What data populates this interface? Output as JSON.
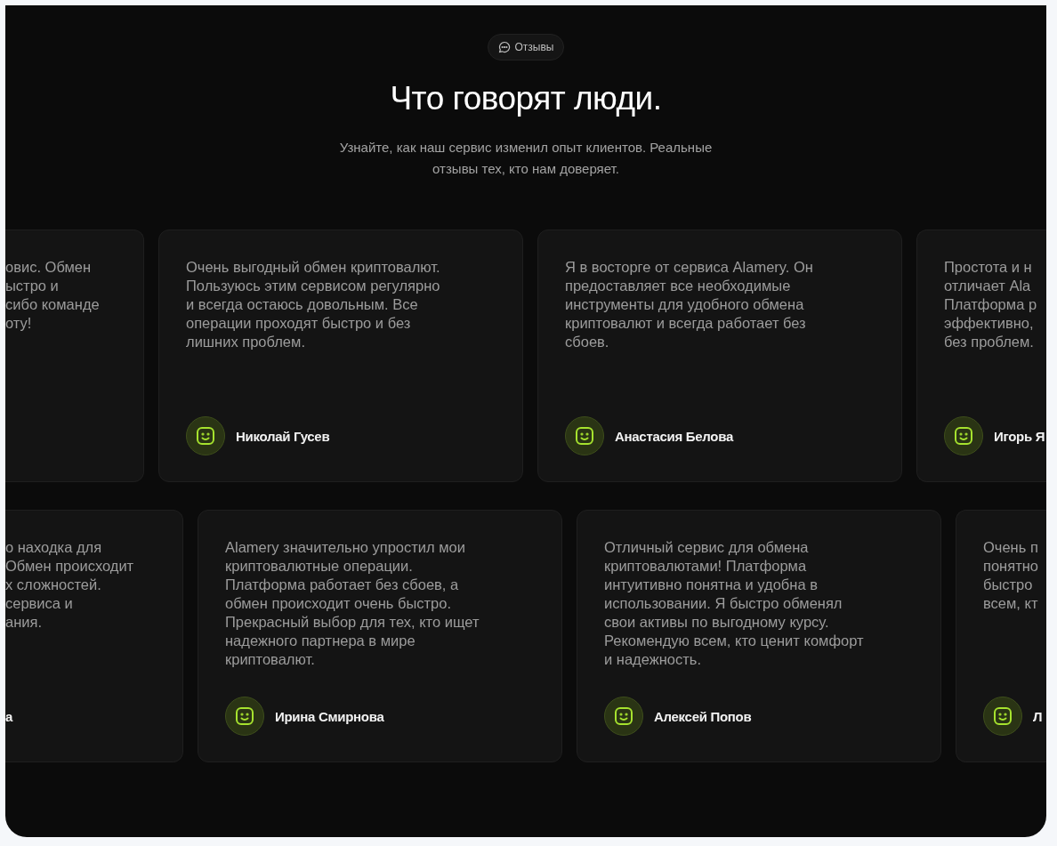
{
  "badge": {
    "label": "Отзывы"
  },
  "title": "Что говорят люди.",
  "subtitle_lines": [
    "Узнайте, как наш сервис изменил опыт клиентов. Реальные",
    "отзывы тех, кто нам доверяет."
  ],
  "rows": [
    {
      "cards": [
        {
          "kind": "cut_left",
          "lines": [
            "овис. Обмен",
            "ыстро и",
            "сибо команде",
            "оту!"
          ]
        },
        {
          "kind": "full",
          "lines": [
            "Очень выгодный обмен криптовалют.",
            "Пользуюсь этим сервисом регулярно",
            "и всегда остаюсь довольным. Все",
            "операции проходят быстро и без",
            "лишних проблем."
          ],
          "name": "Николай Гусев"
        },
        {
          "kind": "full",
          "lines": [
            "Я в восторге от сервиса Alamery. Он",
            "предоставляет все необходимые",
            "инструменты для удобного обмена",
            "криптовалют и всегда работает без",
            "сбоев."
          ],
          "name": "Анастасия Белова"
        },
        {
          "kind": "cut_right",
          "lines": [
            "Простота и н",
            "отличает Ala",
            "Платформа р",
            "эффективно,",
            "без проблем."
          ],
          "name": "Игорь Я"
        }
      ]
    },
    {
      "cards": [
        {
          "kind": "cut_left",
          "lines": [
            "о находка для",
            "Обмен происходит",
            "х сложностей.",
            "сервиса и",
            "ания."
          ],
          "name": "а"
        },
        {
          "kind": "full",
          "lines": [
            "Alamery значительно упростил мои",
            "криптовалютные операции.",
            "Платформа работает без сбоев, а",
            "обмен происходит очень быстро.",
            "Прекрасный выбор для тех, кто ищет",
            "надежного партнера в мире",
            "криптовалют."
          ],
          "name": "Ирина Смирнова"
        },
        {
          "kind": "full",
          "lines": [
            "Отличный сервис для обмена",
            "криптовалютами! Платформа",
            "интуитивно понятна и удобна в",
            "использовании. Я быстро обменял",
            "свои активы по выгодному курсу.",
            "Рекомендую всем, кто ценит комфорт",
            "и надежность."
          ],
          "name": "Алексей Попов"
        },
        {
          "kind": "cut_right",
          "lines": [
            "Очень п",
            "понятно",
            "быстро",
            "всем, кт"
          ],
          "name": "Л"
        }
      ]
    }
  ]
}
